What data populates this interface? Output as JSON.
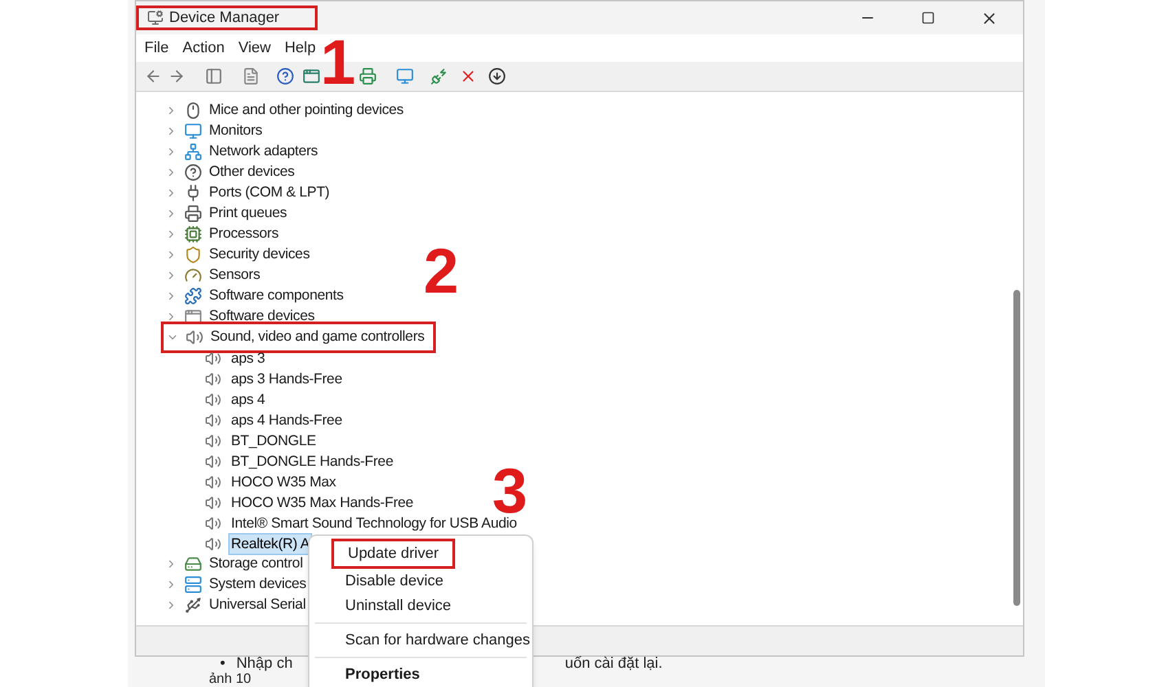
{
  "window": {
    "title": "Device Manager",
    "title_annotated": true,
    "menu": [
      "File",
      "Action",
      "View",
      "Help"
    ]
  },
  "tree": [
    {
      "label": "Mice and other pointing devices",
      "expanded": false,
      "annotated": false
    },
    {
      "label": "Monitors",
      "expanded": false,
      "annotated": false
    },
    {
      "label": "Network adapters",
      "expanded": false,
      "annotated": false
    },
    {
      "label": "Other devices",
      "expanded": false,
      "annotated": false
    },
    {
      "label": "Ports (COM & LPT)",
      "expanded": false,
      "annotated": false
    },
    {
      "label": "Print queues",
      "expanded": false,
      "annotated": false
    },
    {
      "label": "Processors",
      "expanded": false,
      "annotated": false
    },
    {
      "label": "Security devices",
      "expanded": false,
      "annotated": false
    },
    {
      "label": "Sensors",
      "expanded": false,
      "annotated": false
    },
    {
      "label": "Software components",
      "expanded": false,
      "annotated": false
    },
    {
      "label": "Software devices",
      "expanded": false,
      "annotated": false
    },
    {
      "label": "Sound, video and game controllers",
      "expanded": true,
      "annotated": true,
      "children": [
        {
          "label": "aps 3",
          "selected": false
        },
        {
          "label": "aps 3 Hands-Free",
          "selected": false
        },
        {
          "label": "aps 4",
          "selected": false
        },
        {
          "label": "aps 4 Hands-Free",
          "selected": false
        },
        {
          "label": "BT_DONGLE",
          "selected": false
        },
        {
          "label": "BT_DONGLE Hands-Free",
          "selected": false
        },
        {
          "label": "HOCO W35 Max",
          "selected": false
        },
        {
          "label": "HOCO W35 Max Hands-Free",
          "selected": false
        },
        {
          "label": "Intel® Smart Sound Technology for USB Audio",
          "selected": false
        },
        {
          "label": "Realtek(R) A",
          "selected": true
        }
      ]
    },
    {
      "label": "Storage control",
      "expanded": false,
      "annotated": false
    },
    {
      "label": "System devices",
      "expanded": false,
      "annotated": false
    },
    {
      "label": "Universal Serial",
      "expanded": false,
      "annotated": false
    }
  ],
  "context_menu": [
    {
      "label": "Update driver",
      "kind": "item",
      "annotated": true
    },
    {
      "label": "Disable device",
      "kind": "item",
      "annotated": false
    },
    {
      "label": "Uninstall device",
      "kind": "item",
      "annotated": false
    },
    {
      "kind": "separator"
    },
    {
      "label": "Scan for hardware changes",
      "kind": "item",
      "annotated": false
    },
    {
      "kind": "separator"
    },
    {
      "label": "Properties",
      "kind": "default",
      "annotated": false
    }
  ],
  "document": {
    "bullet": "•",
    "line_start": "Nhập ch",
    "line_end": "uốn cài đặt lại.",
    "caption": "ảnh 10"
  },
  "annotations": [
    {
      "number": "1"
    },
    {
      "number": "2"
    },
    {
      "number": "3"
    }
  ]
}
